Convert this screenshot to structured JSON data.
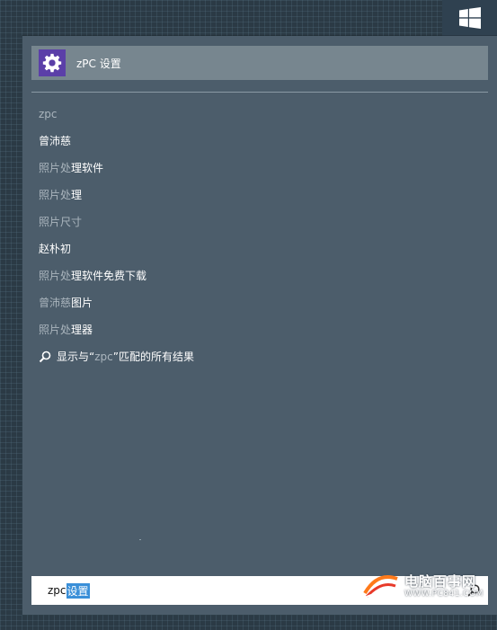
{
  "top_result": {
    "icon": "gear-icon",
    "label": "zPC 设置",
    "icon_bg": "#5b3fa8"
  },
  "suggestions": [
    {
      "dim": "zpc",
      "bold": ""
    },
    {
      "dim": "",
      "bold": "曾沛慈"
    },
    {
      "dim": "照片处",
      "bold": "理软件"
    },
    {
      "dim": "照片处",
      "bold": "理"
    },
    {
      "dim": "照片尺寸",
      "bold": ""
    },
    {
      "dim": "",
      "bold": "赵朴初"
    },
    {
      "dim": "照片处",
      "bold": "理软件免费下载"
    },
    {
      "dim": "曾沛慈",
      "bold": "图片"
    },
    {
      "dim": "照片处",
      "bold": "理器"
    }
  ],
  "show_all": {
    "prefix": "显示与“",
    "query": "zpc",
    "suffix": "”匹配的所有结果"
  },
  "searchbox": {
    "typed": "zpc",
    "ime_text": "设置"
  },
  "watermark": {
    "title": "电脑百事网",
    "url": "WWW.PC841.COM"
  },
  "colors": {
    "pane": "#4c5d6b",
    "highlight": "#77868f",
    "ime": "#3a8fd8"
  }
}
